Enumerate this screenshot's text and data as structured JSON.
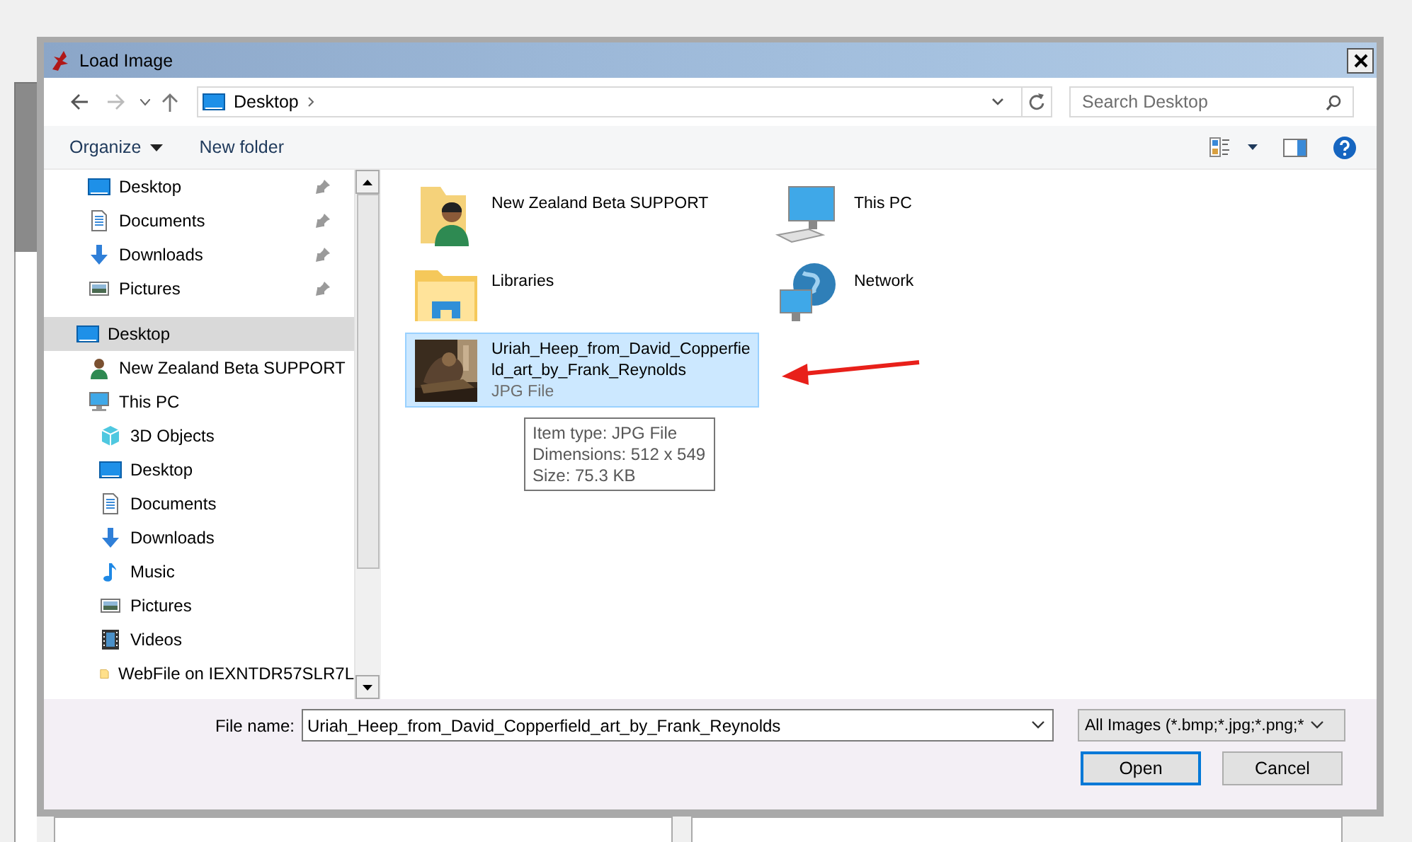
{
  "window": {
    "title": "Load Image"
  },
  "address_bar": {
    "path": [
      "Desktop"
    ]
  },
  "search": {
    "placeholder": "Search Desktop"
  },
  "toolbar": {
    "buttons": [
      {
        "label": "Organize",
        "kind": "menu"
      },
      {
        "label": "New folder",
        "kind": "plain"
      }
    ]
  },
  "navigation": {
    "quick_access": [
      {
        "label": "Desktop",
        "kind": "desktop",
        "pinned": true,
        "selected": false
      },
      {
        "label": "Documents",
        "kind": "documents",
        "pinned": true,
        "selected": false
      },
      {
        "label": "Downloads",
        "kind": "downloads",
        "pinned": true,
        "selected": false
      },
      {
        "label": "Pictures",
        "kind": "pictures",
        "pinned": true,
        "selected": false
      }
    ],
    "tree": [
      {
        "label": "Desktop",
        "kind": "desktop",
        "selected": true,
        "children": [
          {
            "label": "New Zealand Beta SUPPORT",
            "kind": "user",
            "selected": false
          },
          {
            "label": "This PC",
            "kind": "pc",
            "selected": false,
            "children": [
              {
                "label": "3D Objects",
                "kind": "objects",
                "selected": false
              },
              {
                "label": "Desktop",
                "kind": "desktop",
                "selected": false
              },
              {
                "label": "Documents",
                "kind": "documents",
                "selected": false
              },
              {
                "label": "Downloads",
                "kind": "downloads",
                "selected": false
              },
              {
                "label": "Music",
                "kind": "music",
                "selected": false
              },
              {
                "label": "Pictures",
                "kind": "pictures",
                "selected": false
              },
              {
                "label": "Videos",
                "kind": "videos",
                "selected": false
              },
              {
                "label": "WebFile on IEXNTDR57SLR7L",
                "kind": "folder",
                "selected": false
              }
            ]
          }
        ]
      }
    ]
  },
  "files": [
    {
      "name": "New Zealand Beta SUPPORT",
      "kind": "user",
      "selected": false
    },
    {
      "name": "This PC",
      "kind": "pc",
      "selected": false
    },
    {
      "name": "Libraries",
      "kind": "libraries",
      "selected": false
    },
    {
      "name": "Network",
      "kind": "network",
      "selected": false
    },
    {
      "name": "Uriah_Heep_from_David_Copperfield_art_by_Frank_Reynolds",
      "kind": "picture",
      "type": "JPG File",
      "selected": true
    }
  ],
  "tooltip": {
    "lines": [
      "Item type: JPG File",
      "Dimensions: 512 x 549",
      "Size: 75.3 KB"
    ]
  },
  "footer": {
    "file_name_label": "File name:",
    "file_name": "Uriah_Heep_from_David_Copperfield_art_by_Frank_Reynolds",
    "filter": "All Images (*.bmp;*.jpg;*.png;*",
    "buttons": [
      {
        "label": "Open",
        "default": true
      },
      {
        "label": "Cancel",
        "default": false
      }
    ]
  }
}
